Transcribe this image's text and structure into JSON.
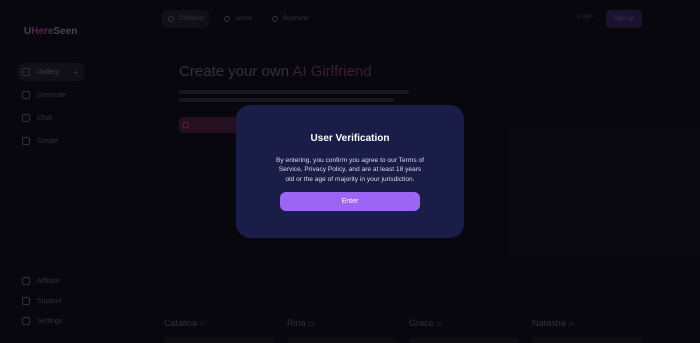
{
  "brand": {
    "name_part1": "U",
    "name_part2": "Here",
    "name_part3": "Seen"
  },
  "sidebar": {
    "items": [
      {
        "label": "Gallery"
      },
      {
        "label": "Generate"
      },
      {
        "label": "Chat"
      },
      {
        "label": "Create"
      }
    ],
    "bottom": [
      {
        "label": "Affiliate"
      },
      {
        "label": "Support"
      },
      {
        "label": "Settings"
      }
    ]
  },
  "topbar": {
    "tabs": [
      {
        "label": "Girlfriend"
      },
      {
        "label": "Anime"
      },
      {
        "label": "Boyfriend"
      }
    ],
    "login_label": "Login",
    "join_label": "Sign up"
  },
  "hero": {
    "title_prefix": "Create your own ",
    "title_accent": "AI Girlfriend"
  },
  "characters": [
    {
      "name": "Catalina",
      "age": "27"
    },
    {
      "name": "Rina",
      "age": "23"
    },
    {
      "name": "Grace",
      "age": "25"
    },
    {
      "name": "Natasha",
      "age": "26"
    }
  ],
  "modal": {
    "title": "User Verification",
    "body": "By entering, you confirm you agree to our Terms of Service, Privacy Policy, and are at least 18 years old or the age of majority in your jurisdiction.",
    "enter_label": "Enter",
    "colors": {
      "background": "#1a1d47",
      "button": "#9d65f4"
    }
  }
}
